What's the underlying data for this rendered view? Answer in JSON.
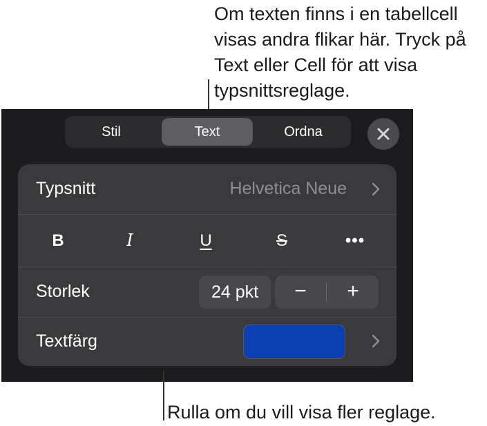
{
  "annotations": {
    "top_callout": "Om texten finns i en tabellcell visas andra flikar här. Tryck på Text eller Cell för att visa typsnittsreglage.",
    "bottom_callout": "Rulla om du vill visa fler reglage."
  },
  "tabs": {
    "stil": "Stil",
    "text": "Text",
    "ordna": "Ordna",
    "selected": "Text"
  },
  "close_icon": "close-icon",
  "font_row": {
    "label": "Typsnitt",
    "value": "Helvetica Neue",
    "icon": "chevron-right-icon"
  },
  "style_row": {
    "bold": "B",
    "italic": "I",
    "underline": "U",
    "strikethrough": "S",
    "more": "•••"
  },
  "size_row": {
    "label": "Storlek",
    "value": "24 pkt",
    "minus": "−",
    "plus": "+"
  },
  "color_row": {
    "label": "Textfärg",
    "swatch_color": "#0a3fb0",
    "icon": "chevron-right-icon"
  },
  "colors": {
    "panel_bg": "#1c1c1e",
    "card_bg": "#3a3a3c",
    "selected_tab": "#5d5d62"
  }
}
